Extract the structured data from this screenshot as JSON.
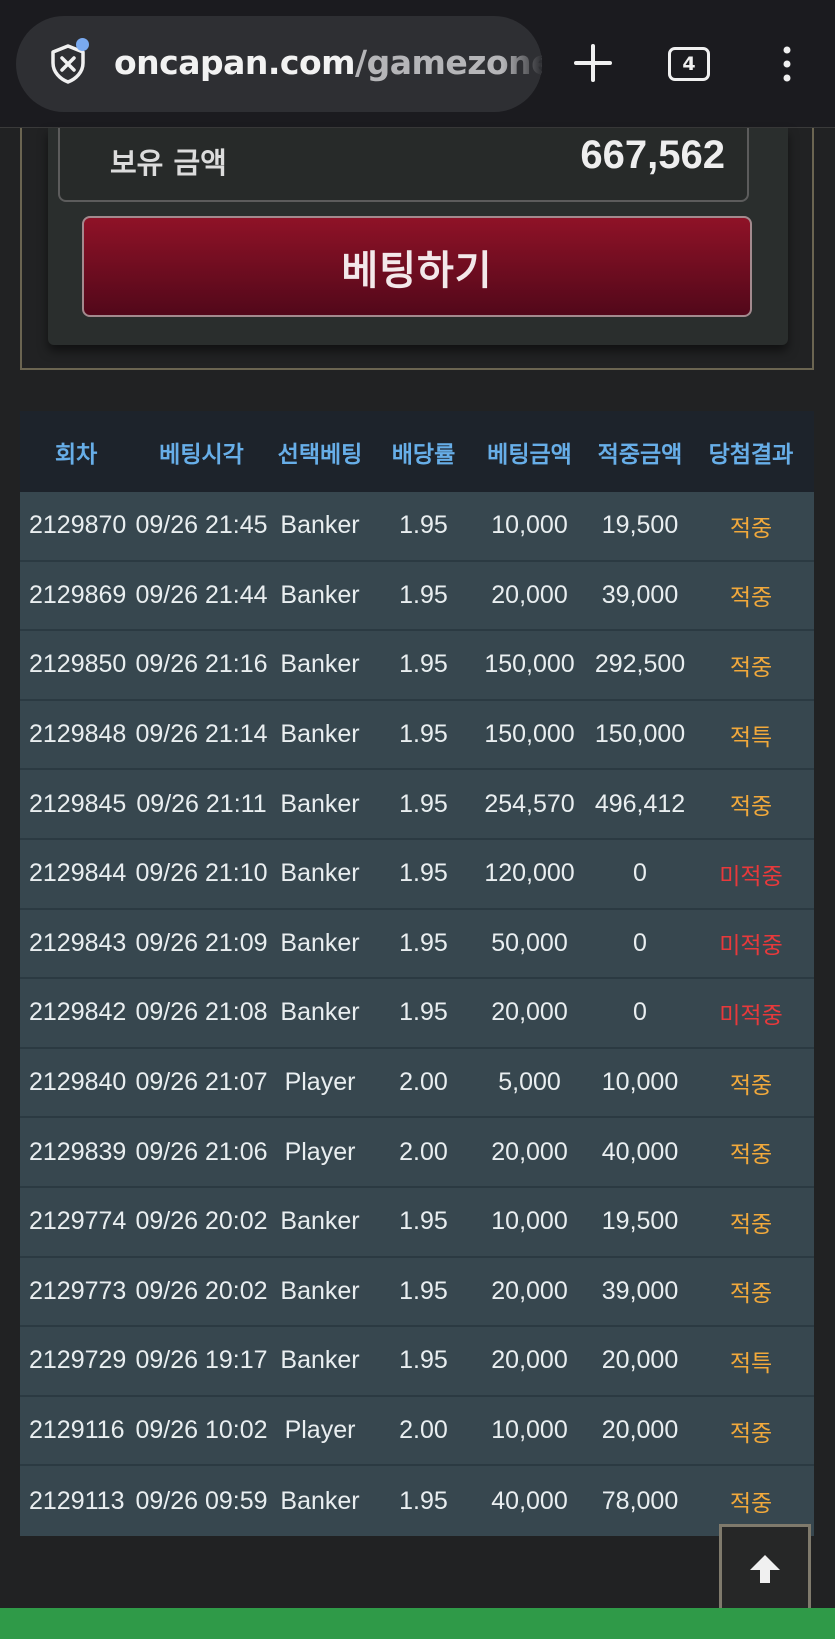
{
  "browser": {
    "url_domain": "oncapan.com",
    "url_path": "/gamezone",
    "tab_count": "4"
  },
  "balance": {
    "label": "보유 금액",
    "value": "667,562"
  },
  "bet_button_label": "베팅하기",
  "table": {
    "headers": [
      "회차",
      "베팅시각",
      "선택베팅",
      "배당률",
      "베팅금액",
      "적중금액",
      "당첨결과"
    ],
    "rows": [
      [
        "2129870",
        "09/26 21:45",
        "Banker",
        "1.95",
        "10,000",
        "19,500",
        "적중"
      ],
      [
        "2129869",
        "09/26 21:44",
        "Banker",
        "1.95",
        "20,000",
        "39,000",
        "적중"
      ],
      [
        "2129850",
        "09/26 21:16",
        "Banker",
        "1.95",
        "150,000",
        "292,500",
        "적중"
      ],
      [
        "2129848",
        "09/26 21:14",
        "Banker",
        "1.95",
        "150,000",
        "150,000",
        "적특"
      ],
      [
        "2129845",
        "09/26 21:11",
        "Banker",
        "1.95",
        "254,570",
        "496,412",
        "적중"
      ],
      [
        "2129844",
        "09/26 21:10",
        "Banker",
        "1.95",
        "120,000",
        "0",
        "미적중"
      ],
      [
        "2129843",
        "09/26 21:09",
        "Banker",
        "1.95",
        "50,000",
        "0",
        "미적중"
      ],
      [
        "2129842",
        "09/26 21:08",
        "Banker",
        "1.95",
        "20,000",
        "0",
        "미적중"
      ],
      [
        "2129840",
        "09/26 21:07",
        "Player",
        "2.00",
        "5,000",
        "10,000",
        "적중"
      ],
      [
        "2129839",
        "09/26 21:06",
        "Player",
        "2.00",
        "20,000",
        "40,000",
        "적중"
      ],
      [
        "2129774",
        "09/26 20:02",
        "Banker",
        "1.95",
        "10,000",
        "19,500",
        "적중"
      ],
      [
        "2129773",
        "09/26 20:02",
        "Banker",
        "1.95",
        "20,000",
        "39,000",
        "적중"
      ],
      [
        "2129729",
        "09/26 19:17",
        "Banker",
        "1.95",
        "20,000",
        "20,000",
        "적특"
      ],
      [
        "2129116",
        "09/26 10:02",
        "Player",
        "2.00",
        "10,000",
        "20,000",
        "적중"
      ],
      [
        "2129113",
        "09/26 09:59",
        "Banker",
        "1.95",
        "40,000",
        "78,000",
        "적중"
      ]
    ]
  },
  "colors": {
    "result_win": "#f2a93b",
    "result_lose": "#e8393b",
    "header_text": "#67aee8",
    "bet_button": "#8f1227"
  },
  "icons": {
    "shield": "shield-x-icon",
    "new_tab": "plus-icon",
    "menu": "kebab-menu-icon",
    "scroll_top": "arrow-up-icon"
  }
}
